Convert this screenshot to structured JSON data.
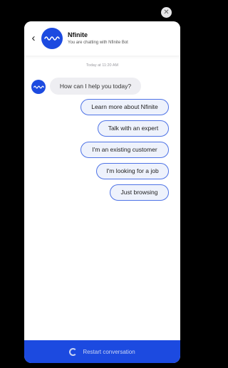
{
  "chat": {
    "close_icon": "close-icon",
    "header": {
      "back_icon": "chevron-left-icon",
      "logo_icon": "nfinite-logo-icon",
      "title": "Nfinite",
      "subtitle": "You are chatting with Nfinite Bot"
    },
    "timestamp": "Today at 11:20 AM",
    "bot_message": "How can I help you today?",
    "options": [
      "Learn more about Nfinite",
      "Talk with an expert",
      "I'm an existing customer",
      "I'm looking for a job",
      "Just browsing"
    ],
    "footer": {
      "restart_icon": "restart-icon",
      "restart_label": "Restart conversation"
    },
    "colors": {
      "brand": "#1c4ae0",
      "option_border": "#4e73e6",
      "option_bg": "#eef2fc",
      "bot_bubble_bg": "#eeeef2"
    }
  }
}
